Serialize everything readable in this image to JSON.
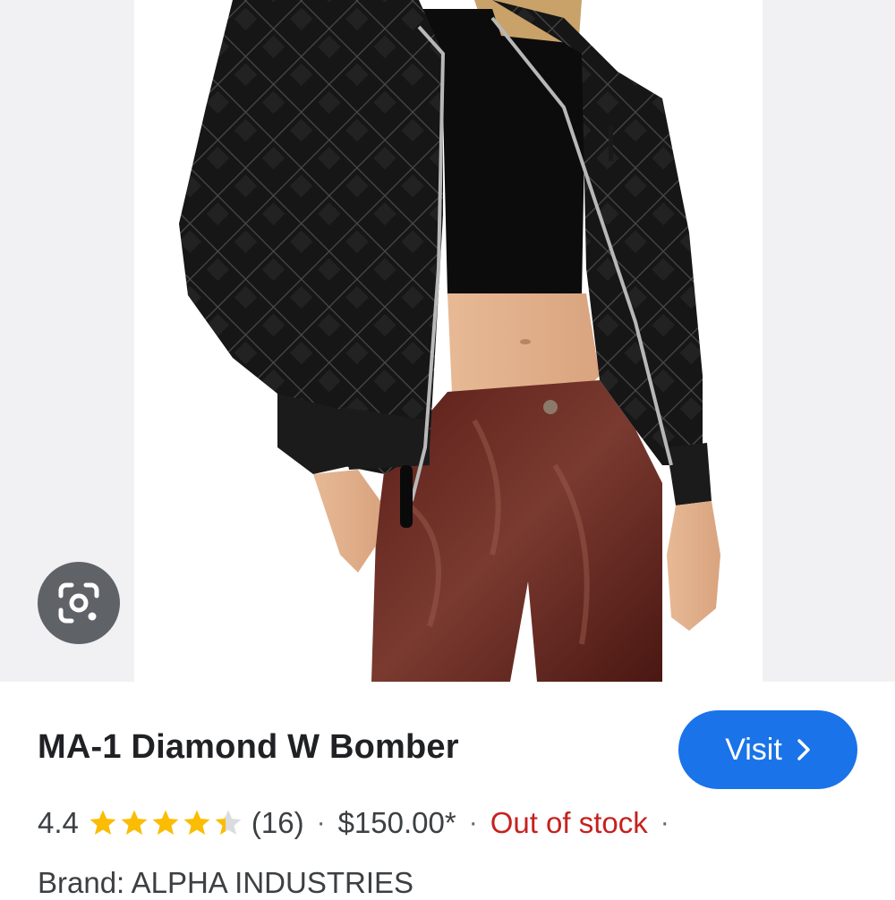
{
  "product": {
    "title": "MA-1 Diamond W Bomber",
    "rating": "4.4",
    "rating_value": 4.4,
    "rating_max": 5,
    "review_count": "(16)",
    "price": "$150.00*",
    "availability": "Out of stock",
    "brand_label": "Brand:",
    "brand": "ALPHA INDUSTRIES",
    "separator": "·"
  },
  "actions": {
    "visit_label": "Visit",
    "visit_icon": "chevron-right-icon",
    "lens_icon": "google-lens-icon"
  },
  "colors": {
    "visit_button": "#1a73e8",
    "star_filled": "#fbbc04",
    "star_empty": "#dadce0",
    "out_of_stock": "#c5221f",
    "lens_button": "#5f6368"
  }
}
